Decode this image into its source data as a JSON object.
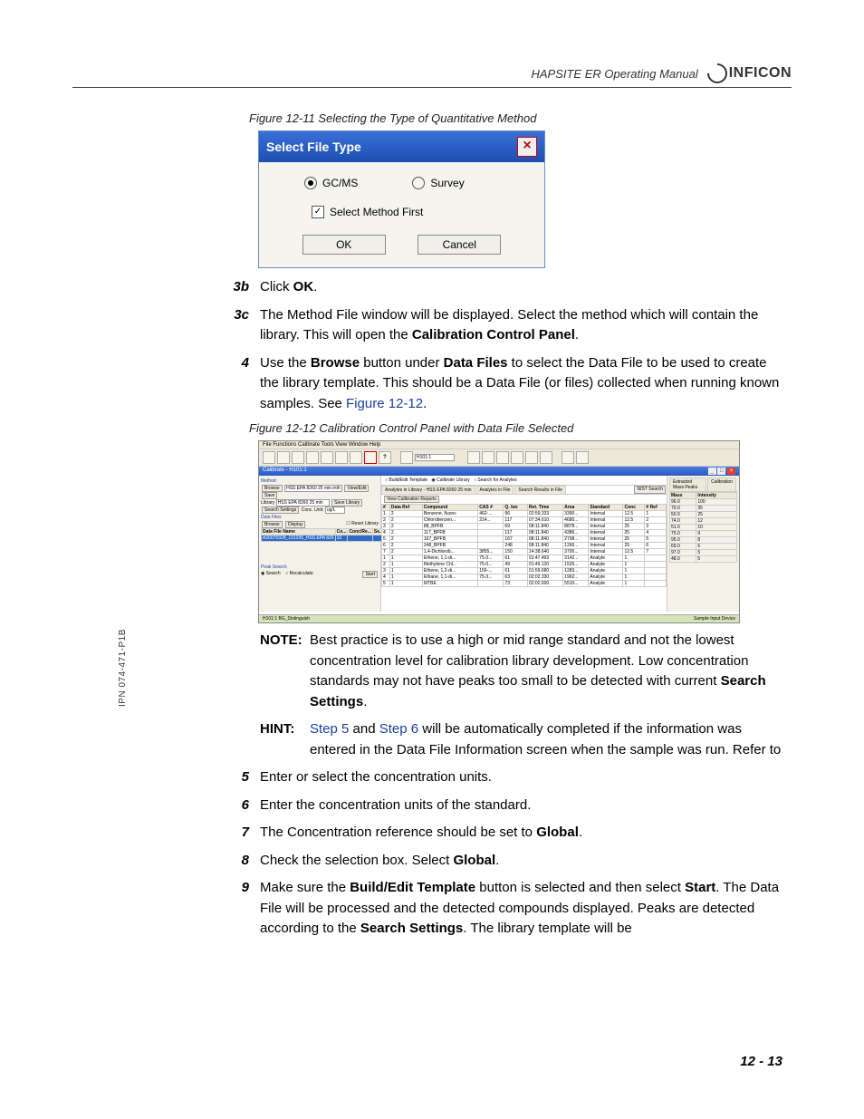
{
  "header": {
    "manual_title": "HAPSITE ER Operating Manual",
    "brand": "INFICON"
  },
  "side_label": "IPN 074-471-P1B",
  "page_number": "12 - 13",
  "fig11": {
    "caption": "Figure 12-11  Selecting the Type of Quantitative Method",
    "dialog_title": "Select File Type",
    "opt_gcms": "GC/MS",
    "opt_survey": "Survey",
    "checkbox_label": "Select Method First",
    "btn_ok": "OK",
    "btn_cancel": "Cancel"
  },
  "steps": {
    "s3b": {
      "num": "3b",
      "pre": "Click ",
      "bold": "OK",
      "post": "."
    },
    "s3c": {
      "num": "3c",
      "text_a": "The Method File window will be displayed. Select the method which will contain the library. This will open the ",
      "bold": "Calibration Control Panel",
      "post": "."
    },
    "s4": {
      "num": "4",
      "a": "Use the ",
      "b1": "Browse",
      "b": " button under ",
      "b2": "Data Files",
      "c": " to select the Data File to be used to create the library template. This should be a Data File (or files) collected when running known samples. See ",
      "link": "Figure 12-12",
      "post": "."
    },
    "s5": {
      "num": "5",
      "text": "Enter or select the concentration units."
    },
    "s6": {
      "num": "6",
      "text": "Enter the concentration units of the standard."
    },
    "s7": {
      "num": "7",
      "a": "The Concentration reference should be set to ",
      "b": "Global",
      "post": "."
    },
    "s8": {
      "num": "8",
      "a": "Check the selection box. Select ",
      "b": "Global",
      "post": "."
    },
    "s9": {
      "num": "9",
      "a": "Make sure the ",
      "b1": "Build/Edit Template",
      "b": " button is selected and then select ",
      "b2": "Start",
      "c": ". The Data File will be processed and the detected compounds displayed. Peaks are detected according to the ",
      "b3": "Search Settings",
      "d": ". The library template will be"
    }
  },
  "fig12": {
    "caption": "Figure 12-12  Calibration Control Panel with Data File Selected"
  },
  "note": {
    "label": "NOTE:",
    "text_a": "Best practice is to use a high or mid range standard and not the lowest concentration level for calibration library development. Low concentration standards may not have peaks too small to be detected with current ",
    "bold": "Search Settings",
    "post": "."
  },
  "hint": {
    "label": "HINT:",
    "link1": "Step 5",
    "mid1": " and ",
    "link2": "Step 6",
    "text": " will be automatically completed if the information was entered in the Data File Information screen when the sample was run. Refer to"
  },
  "app": {
    "menu": "File   Functions   Calibrate   Tools   View   Window   Help",
    "combo_value": "H101:1",
    "window_title": "Calibrate - H101:1",
    "left": {
      "method_label": "Method",
      "browse": "Browse",
      "method_path": "HSS EPA 8260 25 min.mth",
      "view_edit": "View/Edit",
      "save": "Save",
      "library_label": "Library",
      "library_value": "HSS EPA 8260 25 min",
      "save_library": "Save Library",
      "search_settings": "Search Settings",
      "conc_unit": "Conc. Unit:",
      "conc_unit_value": "ug/L",
      "data_files": "Data Files",
      "browse2": "Browse",
      "display": "Display",
      "reset_library": "Reset Library",
      "col_datafile": "Data File Name",
      "col_co": "Co...",
      "col_concre": "Conc/Re...",
      "col_se": "Se...",
      "data_file_row": "A20070328_131235_HSS EPA 826",
      "data_file_val": "10",
      "peak_search": "Peak Search",
      "opt_search": "Search",
      "opt_recalculate": "Recalculate",
      "start": "Start"
    },
    "center": {
      "opt_build": "Build/Edit Template",
      "opt_calibrate": "Calibrate Library",
      "opt_search_analytes": "Search for Analytes",
      "tab1": "Analytes in Library - HSS EPA 8260 25 min",
      "tab2": "Analytes in File",
      "tab3": "Search Results in File",
      "nist_search": "NIST Search",
      "view_cal_reports": "View Calibration Reports",
      "headers": [
        "#",
        "Data Ref",
        "Compound",
        "CAS #",
        "Q. Ion",
        "Ret. Time",
        "Area",
        "Standard",
        "Conc",
        "# Ref"
      ],
      "rows": [
        [
          "1",
          "2",
          "Benzene, fluoro-",
          "462-...",
          "96",
          "02:59.333",
          "3390...",
          "Internal",
          "12.5",
          "1"
        ],
        [
          "2",
          "2",
          "Chlorobenzen...",
          "214...",
          "117",
          "07:34.610",
          "4680...",
          "Internal",
          "12.5",
          "2"
        ],
        [
          "3",
          "2",
          "88_BPFB",
          "",
          "69",
          "08:11.840",
          "8878...",
          "Internal",
          "25",
          "3"
        ],
        [
          "4",
          "2",
          "117_BPFB",
          "",
          "117",
          "08:11.840",
          "4386...",
          "Internal",
          "25",
          "4"
        ],
        [
          "5",
          "2",
          "167_BPFB",
          "",
          "167",
          "08:11.840",
          "2708...",
          "Internal",
          "25",
          "5"
        ],
        [
          "6",
          "2",
          "248_BPFB",
          "",
          "248",
          "08:11.840",
          "1266...",
          "Internal",
          "25",
          "6"
        ],
        [
          "7",
          "2",
          "1,4-Dichlorob...",
          "3855...",
          "150",
          "14:38.640",
          "3700...",
          "Internal",
          "12.5",
          "7"
        ],
        [
          "1",
          "1",
          "Ethene, 1,1-di...",
          "75-3...",
          "61",
          "01:47.493",
          "3142...",
          "Analyte",
          "1",
          ""
        ],
        [
          "2",
          "1",
          "Methylene Chl...",
          "75-0...",
          "49",
          "01:49.120",
          "1525...",
          "Analyte",
          "1",
          ""
        ],
        [
          "3",
          "1",
          "Ethene, 1,2-di...",
          "156-...",
          "61",
          "01:59.680",
          "1283...",
          "Analyte",
          "1",
          ""
        ],
        [
          "4",
          "1",
          "Ethane, 1,1-di...",
          "75-3...",
          "63",
          "02:02.330",
          "1962...",
          "Analyte",
          "1",
          ""
        ],
        [
          "5",
          "1",
          "MTBE",
          "",
          "73",
          "02:02.600",
          "5510...",
          "Analyte",
          "1",
          ""
        ]
      ]
    },
    "right": {
      "tab1": "Extracted Mass Peaks",
      "tab2": "Calibration",
      "col_mass": "Mass",
      "col_intensity": "Intensity",
      "rows": [
        [
          "96.0",
          "100"
        ],
        [
          "70.0",
          "35"
        ],
        [
          "50.0",
          "25"
        ],
        [
          "74.0",
          "12"
        ],
        [
          "51.0",
          "10"
        ],
        [
          "75.0",
          "9"
        ],
        [
          "95.0",
          "8"
        ],
        [
          "69.0",
          "6"
        ],
        [
          "97.0",
          "5"
        ],
        [
          "48.0",
          "5"
        ]
      ]
    },
    "status": {
      "left": "H101:1    BG_Distinguish",
      "right": "Sample Input Device"
    }
  }
}
